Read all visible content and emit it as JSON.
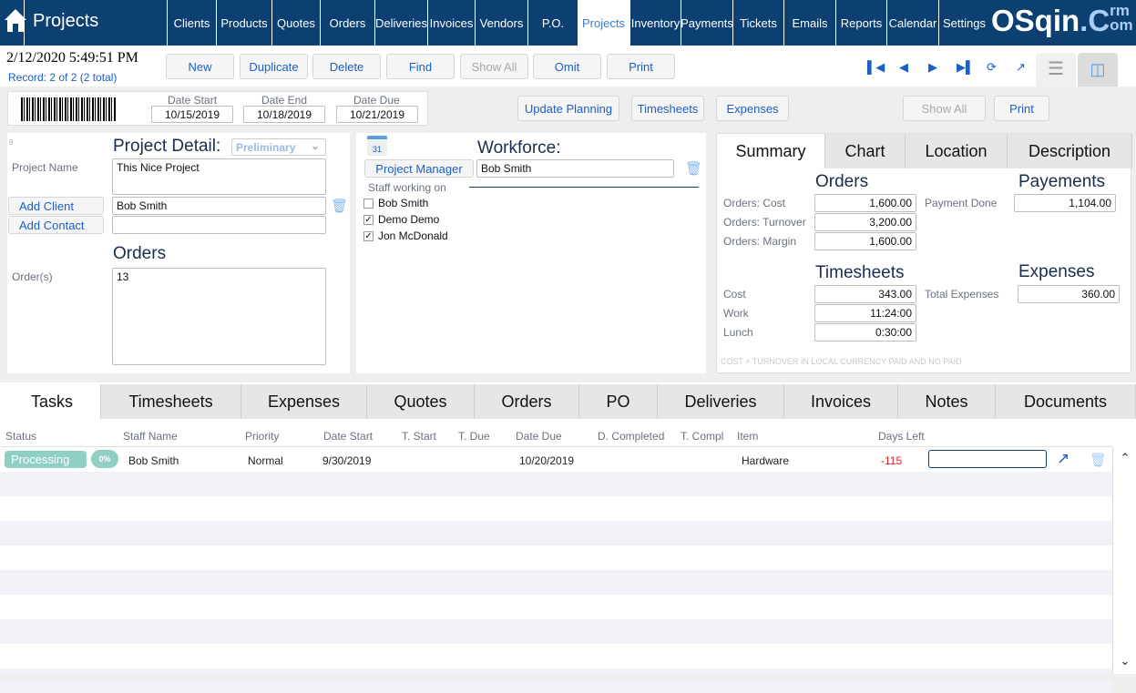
{
  "header": {
    "title": "Projects",
    "logo": "OSqinCrm.com",
    "nav": [
      "Clients",
      "Products",
      "Quotes",
      "Orders",
      "Deliveries",
      "Invoices",
      "Vendors",
      "P.O.",
      "Projects",
      "Inventory",
      "Payments",
      "Tickets",
      "Emails",
      "Reports",
      "Calendar",
      "Settings"
    ],
    "active": "Projects"
  },
  "status": {
    "datetime": "2/12/2020 5:49:51 PM",
    "record": "Record:  2 of 2 (2 total)"
  },
  "toolbar": [
    "New",
    "Duplicate",
    "Delete",
    "Find",
    "Show All",
    "Omit",
    "Print"
  ],
  "dates": {
    "start_label": "Date Start",
    "start": "10/15/2019",
    "end_label": "Date End",
    "end": "10/18/2019",
    "due_label": "Date Due",
    "due": "10/21/2019"
  },
  "actions": {
    "update_planning": "Update Planning",
    "timesheets": "Timesheets",
    "expenses": "Expenses",
    "show_all": "Show All",
    "print": "Print"
  },
  "detail": {
    "id": "9",
    "title": "Project Detail:",
    "status": "Preliminary",
    "name_label": "Project Name",
    "name": "This Nice Project",
    "add_client": "Add Client",
    "client": "Bob Smith",
    "add_contact": "Add Contact",
    "contact": "",
    "orders_title": "Orders",
    "orders_label": "Order(s)",
    "orders": "13"
  },
  "workforce": {
    "title": "Workforce:",
    "pm_button": "Project Manager",
    "pm": "Bob Smith",
    "staff_label": "Staff working on",
    "staff": [
      {
        "name": "Bob Smith",
        "checked": false
      },
      {
        "name": "Demo Demo",
        "checked": true
      },
      {
        "name": "Jon McDonald",
        "checked": true
      }
    ]
  },
  "summary": {
    "tabs": [
      "Summary",
      "Chart",
      "Location",
      "Description"
    ],
    "orders_title": "Orders",
    "cost_label": "Orders: Cost",
    "cost": "1,600.00",
    "turnover_label": "Orders: Turnover",
    "turnover": "3,200.00",
    "margin_label": "Orders: Margin",
    "margin": "1,600.00",
    "payments_title": "Payements",
    "payment_done_label": "Payment Done",
    "payment_done": "1,104.00",
    "timesheets_title": "Timesheets",
    "ts_cost_label": "Cost",
    "ts_cost": "343.00",
    "work_label": "Work",
    "work": "11:24:00",
    "lunch_label": "Lunch",
    "lunch": "0:30:00",
    "expenses_title": "Expenses",
    "total_exp_label": "Total Expenses",
    "total_exp": "360.00",
    "note": "COST + TURNOVER IN LOCAL CURRENCY PAID AND NO PAID"
  },
  "tabs": [
    "Tasks",
    "Timesheets",
    "Expenses",
    "Quotes",
    "Orders",
    "PO",
    "Deliveries",
    "Invoices",
    "Notes",
    "Documents"
  ],
  "table": {
    "columns": [
      "Status",
      "Staff Name",
      "Priority",
      "Date Start",
      "T. Start",
      "T. Due",
      "Date Due",
      "D. Completed",
      "T. Compl",
      "Item",
      "Days Left"
    ],
    "rows": [
      {
        "status": "Processing",
        "progress": "0%",
        "staff": "Bob Smith",
        "priority": "Normal",
        "date_start": "9/30/2019",
        "t_start": "",
        "t_due": "",
        "date_due": "10/20/2019",
        "d_completed": "",
        "t_compl": "",
        "item": "Hardware",
        "days_left": "-115"
      }
    ]
  },
  "colors": {
    "nav": "#0c3f72",
    "accent": "#1a5fc8",
    "status": "#8fcfc4",
    "negative": "#e02020"
  }
}
